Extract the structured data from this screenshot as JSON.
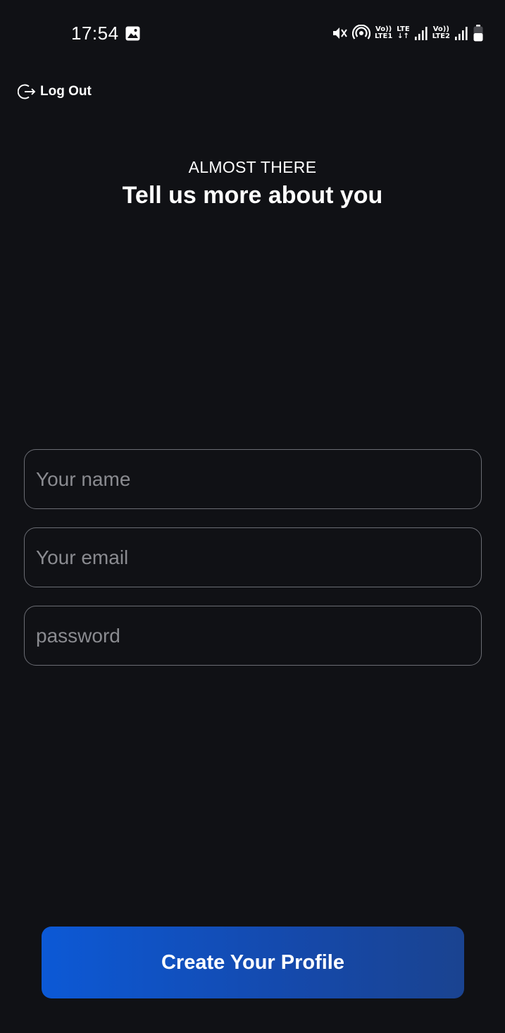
{
  "status_bar": {
    "time": "17:54",
    "icons": [
      "gallery-icon",
      "mute-icon",
      "hotspot-icon",
      "volte-lte1-icon",
      "lte-data-icon",
      "signal-icon",
      "volte-lte2-icon",
      "signal-icon",
      "battery-icon"
    ],
    "sim1_top": "Vo))",
    "sim1_bottom": "LTE1",
    "data_top": "LTE",
    "data_bottom": "↓↑",
    "sim2_top": "Vo))",
    "sim2_bottom": "LTE2"
  },
  "header": {
    "logout_label": "Log Out"
  },
  "intro": {
    "eyebrow": "ALMOST THERE",
    "headline": "Tell us more about you"
  },
  "form": {
    "name_placeholder": "Your name",
    "email_placeholder": "Your email",
    "password_placeholder": "password",
    "name_value": "",
    "email_value": "",
    "password_value": ""
  },
  "cta": {
    "label": "Create Your Profile",
    "gradient_start": "#0c59d6",
    "gradient_end": "#1a4390"
  },
  "theme": {
    "background": "#101115",
    "field_border": "#6b6d74",
    "placeholder": "#8a8b90"
  }
}
